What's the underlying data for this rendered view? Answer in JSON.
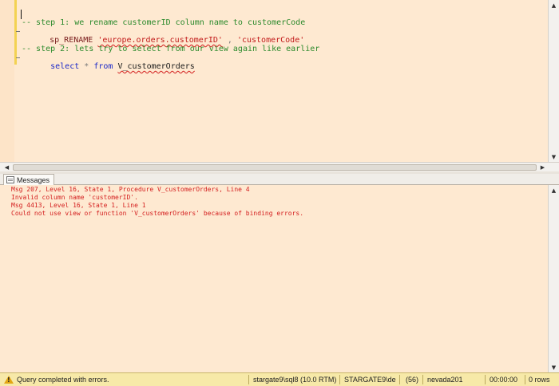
{
  "editor": {
    "lines": [
      {
        "type": "comment",
        "text": "-- step 1: we rename customerID column name to customerCode"
      },
      {
        "type": "exec",
        "proc": "sp_RENAME",
        "arg1": "'europe.orders.customerID'",
        "comma": " , ",
        "arg2": "'customerCode'"
      },
      {
        "type": "comment",
        "text": "-- step 2: lets try to select from our view again like earlier"
      },
      {
        "type": "select",
        "kw_select": "select",
        "star": "*",
        "kw_from": "from",
        "object": "V_customerOrders"
      }
    ]
  },
  "messages_tab": {
    "label": "Messages"
  },
  "messages": [
    "Msg 207, Level 16, State 1, Procedure V_customerOrders, Line 4",
    "Invalid column name 'customerID'.",
    "Msg 4413, Level 16, State 1, Line 1",
    "Could not use view or function 'V_customerOrders' because of binding errors."
  ],
  "status_bar": {
    "message": "Query completed with errors.",
    "server": "stargate9\\sql8 (10.0 RTM)",
    "login": "STARGATE9\\de",
    "spid": "(56)",
    "database": "nevada201",
    "elapsed": "00:00:00",
    "rows": "0 rows"
  },
  "colors": {
    "editor_background": "#fee9d1",
    "comment": "#2c8a2c",
    "keyword": "#1b28c8",
    "string": "#c21a1a",
    "error_text": "#d42020",
    "status_bar": "#f7e9a8"
  },
  "icons": {
    "status": "warning-icon",
    "tab": "messages-icon"
  }
}
